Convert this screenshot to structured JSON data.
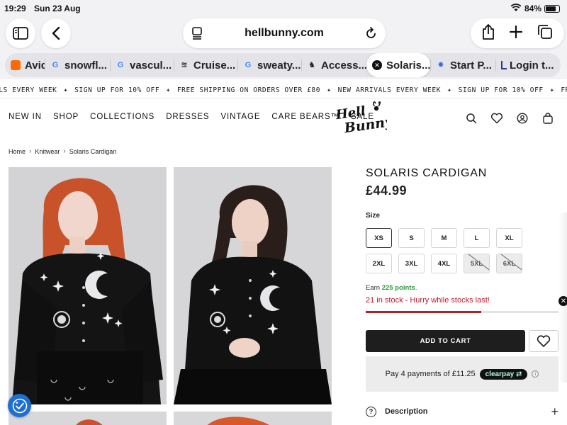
{
  "status": {
    "time": "19:29",
    "date": "Sun 23 Aug",
    "battery": "84%",
    "battery_level": 0.84
  },
  "browser": {
    "url": "hellbunny.com",
    "tabs": [
      {
        "label": "Avid",
        "icon": "avid-favicon",
        "color": "#ff6a00"
      },
      {
        "label": "snowfl...",
        "icon": "google-favicon",
        "color": "#4285f4"
      },
      {
        "label": "vascul...",
        "icon": "google-favicon",
        "color": "#4285f4"
      },
      {
        "label": "Cruise...",
        "icon": "cruise-favicon",
        "color": "#333333"
      },
      {
        "label": "sweaty...",
        "icon": "google-favicon",
        "color": "#4285f4"
      },
      {
        "label": "Access...",
        "icon": "access-favicon",
        "color": "#222222"
      },
      {
        "label": "Solaris...",
        "icon": "close-icon",
        "color": "#111111",
        "active": true
      },
      {
        "label": "Start P...",
        "icon": "start-favicon",
        "color": "#3a6ad6"
      },
      {
        "label": "Login t...",
        "icon": "login-favicon",
        "color": "#2a3a8a"
      }
    ]
  },
  "announcement": {
    "items": [
      "ALS EVERY WEEK",
      "SIGN UP FOR 10% OFF",
      "FREE SHIPPING ON ORDERS OVER £80",
      "NEW ARRIVALS EVERY WEEK",
      "SIGN UP FOR 10% OFF",
      "FREE SHIPPING"
    ],
    "separator": "✦"
  },
  "nav": {
    "links": [
      "NEW IN",
      "SHOP",
      "COLLECTIONS",
      "DRESSES",
      "VINTAGE",
      "CARE BEARS™",
      "SALE"
    ],
    "logo_text": "Hell Bunny"
  },
  "breadcrumb": [
    "Home",
    "Knitwear",
    "Solaris Cardigan"
  ],
  "product": {
    "title": "SOLARIS CARDIGAN",
    "price": "£44.99",
    "size_label": "Size",
    "sizes": [
      {
        "label": "XS",
        "selected": true,
        "available": true
      },
      {
        "label": "S",
        "available": true
      },
      {
        "label": "M",
        "available": true
      },
      {
        "label": "L",
        "available": true
      },
      {
        "label": "XL",
        "available": true
      },
      {
        "label": "2XL",
        "available": true
      },
      {
        "label": "3XL",
        "available": true
      },
      {
        "label": "4XL",
        "available": true
      },
      {
        "label": "5XL",
        "available": false
      },
      {
        "label": "6XL",
        "available": false
      }
    ],
    "earn_prefix": "Earn",
    "earn_points": "225 points",
    "earn_suffix": ".",
    "stock_text": "21 in stock - Hurry while stocks last!",
    "stock_level": 0.6,
    "add_to_cart": "ADD TO CART",
    "clearpay_text": "Pay 4 payments of £11.25",
    "clearpay_brand": "clearpay",
    "description_label": "Description",
    "description_icon": "?"
  },
  "colors": {
    "accent_red": "#c0192c",
    "points_green": "#2a9a3a",
    "cart_bg": "#1e1e1e",
    "access_blue": "#1f6fd0"
  }
}
